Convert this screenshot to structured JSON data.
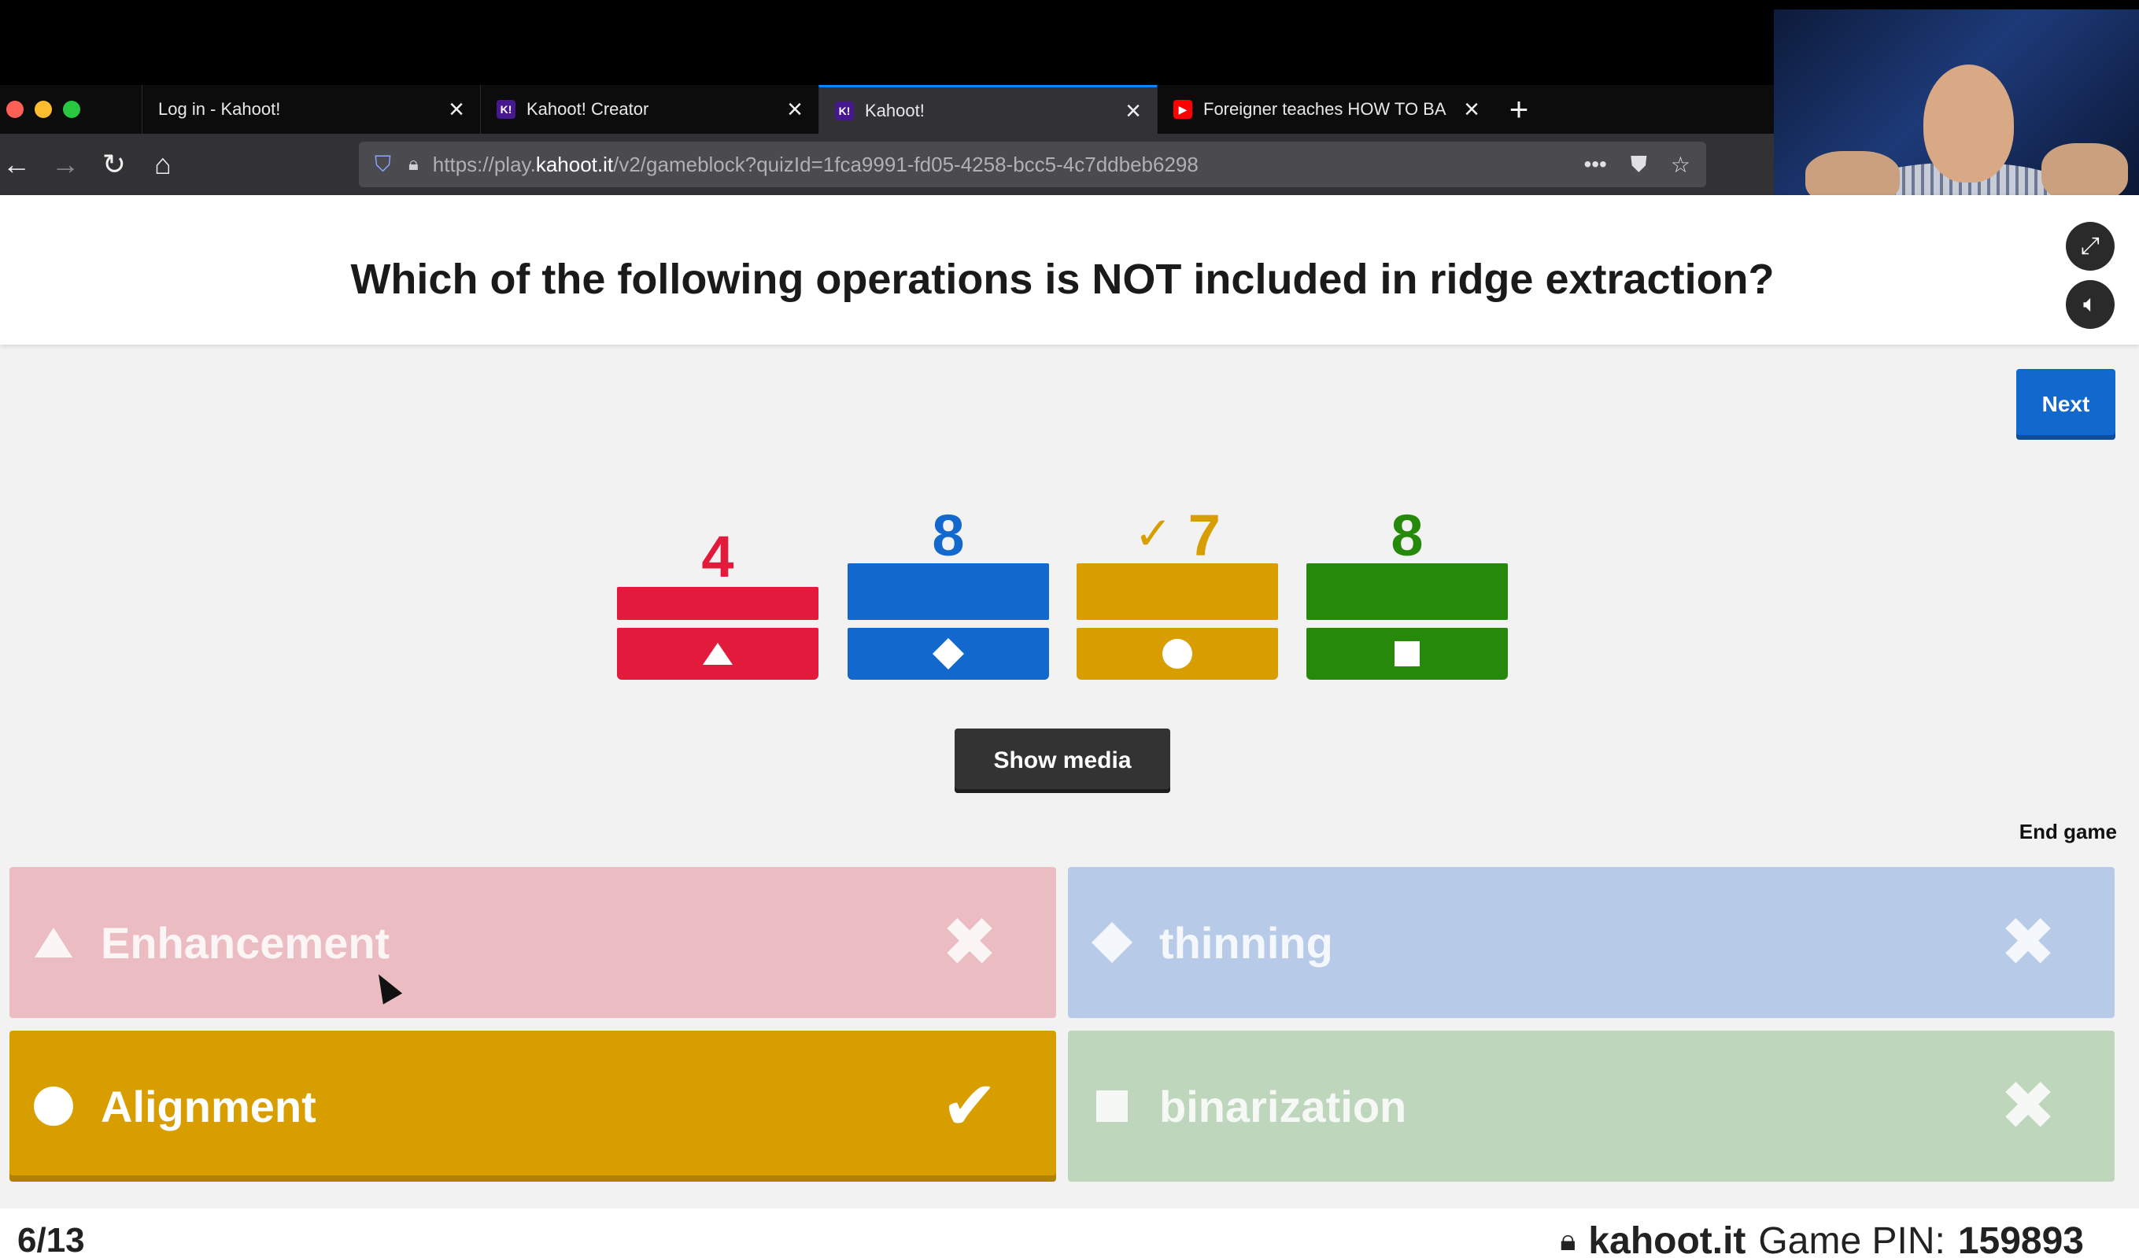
{
  "browser": {
    "tabs": [
      {
        "label": "Log in - Kahoot!",
        "favicon": "none",
        "active": false
      },
      {
        "label": "Kahoot! Creator",
        "favicon": "K!",
        "active": false
      },
      {
        "label": "Kahoot!",
        "favicon": "K!",
        "active": true
      },
      {
        "label": "Foreigner teaches HOW TO BA",
        "favicon": "youtube",
        "active": false
      }
    ],
    "url_prefix": "https://play.",
    "url_domain": "kahoot.it",
    "url_path": "/v2/gameblock?quizId=1fca9991-fd05-4258-bcc5-4c7ddbeb6298",
    "colors": {
      "accent": "#0a84ff"
    }
  },
  "game": {
    "question": "Which of the following operations is  NOT included in ridge extraction?",
    "next_label": "Next",
    "show_media_label": "Show media",
    "end_game_label": "End game",
    "results": [
      {
        "count": "4",
        "shape": "triangle",
        "color": "#e21b3c",
        "correct": false,
        "relative_height": 0.55
      },
      {
        "count": "8",
        "shape": "diamond",
        "color": "#1368ce",
        "correct": false,
        "relative_height": 1.0
      },
      {
        "count": "7",
        "shape": "circle",
        "color": "#d89e00",
        "correct": true,
        "relative_height": 1.0
      },
      {
        "count": "8",
        "shape": "square",
        "color": "#26890c",
        "correct": false,
        "relative_height": 1.0
      }
    ],
    "correct_mark": "✓",
    "answers": [
      {
        "label": "Enhancement",
        "shape": "triangle",
        "color": "#ecbcc3",
        "correct": false,
        "mark": "✖"
      },
      {
        "label": "thinning",
        "shape": "diamond",
        "color": "#b7cbe8",
        "correct": false,
        "mark": "✖"
      },
      {
        "label": "Alignment",
        "shape": "circle",
        "color": "#d89e00",
        "correct": true,
        "mark": "✔"
      },
      {
        "label": "binarization",
        "shape": "square",
        "color": "#bed6bc",
        "correct": false,
        "mark": "✖"
      }
    ],
    "progress": "6/13",
    "site": "kahoot.it",
    "pin_label": "Game PIN:",
    "pin": "159893"
  }
}
